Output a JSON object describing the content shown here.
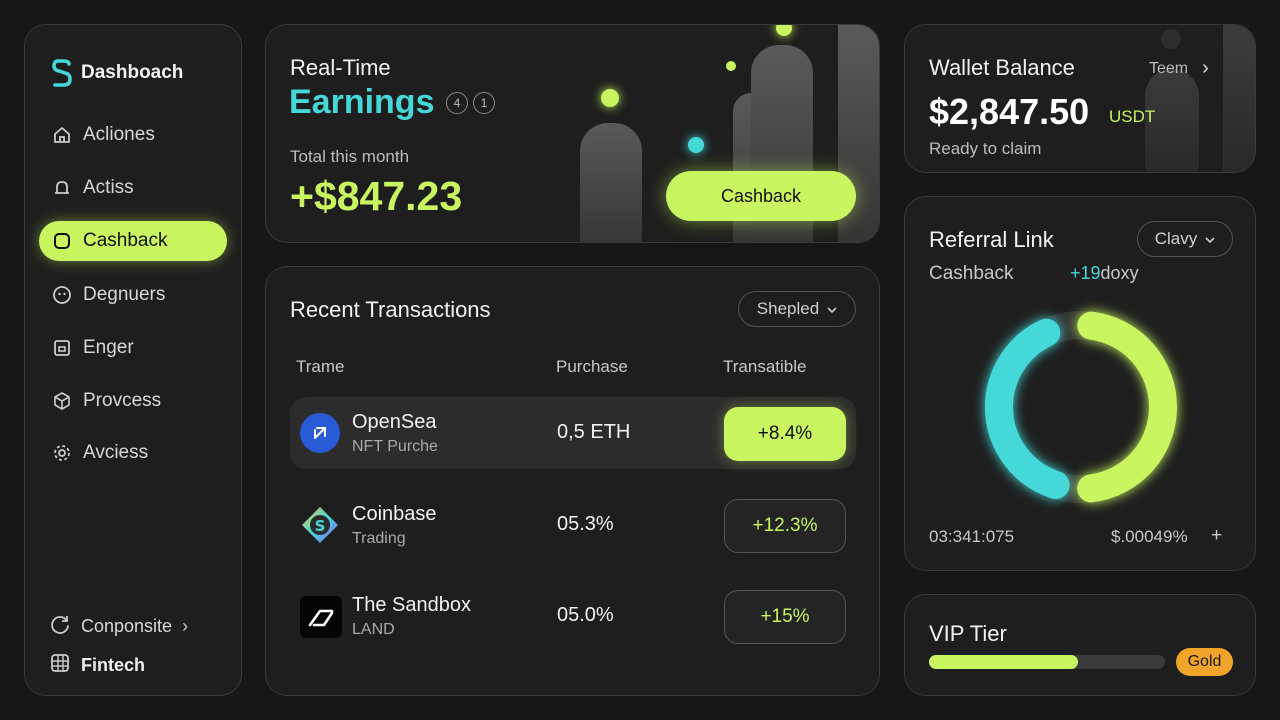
{
  "sidebar": {
    "brand": "Dashboach",
    "items": [
      {
        "label": "Acliones",
        "icon": "home-icon"
      },
      {
        "label": "Actiss",
        "icon": "bell-icon"
      },
      {
        "label": "Cashback",
        "icon": "square-icon",
        "active": true
      },
      {
        "label": "Degnuers",
        "icon": "face-icon"
      },
      {
        "label": "Enger",
        "icon": "wallet-icon"
      },
      {
        "label": "Provcess",
        "icon": "cube-icon"
      },
      {
        "label": "Avciess",
        "icon": "gear-icon"
      }
    ],
    "footer": [
      {
        "label": "Conponsite",
        "icon": "refresh-icon"
      },
      {
        "label": "Fintech",
        "icon": "grid-icon"
      }
    ]
  },
  "earnings": {
    "title_line1": "Real-Time",
    "title_line2": "Earnings",
    "badges": [
      "4",
      "1"
    ],
    "subtitle": "Total this month",
    "amount": "+$847.23",
    "button": "Cashback"
  },
  "transactions": {
    "title": "Recent Transactions",
    "filter": "Shepled",
    "columns": [
      "Trame",
      "Purchase",
      "Transatible"
    ],
    "rows": [
      {
        "name": "OpenSea",
        "desc": "NFT Purche",
        "purchase": "0,5 ETH",
        "change": "+8.4%"
      },
      {
        "name": "Coinbase",
        "desc": "Trading",
        "purchase": "05.3%",
        "change": "+12.3%"
      },
      {
        "name": "The Sandbox",
        "desc": "LAND",
        "purchase": "05.0%",
        "change": "+15%"
      }
    ]
  },
  "wallet": {
    "title": "Wallet Balance",
    "link": "Teem",
    "amount": "$2,847.50",
    "unit": "USDT",
    "status": "Ready to claim"
  },
  "referral": {
    "title": "Referral Link",
    "filter": "Clavy",
    "label": "Cashback",
    "pct": "+19",
    "pct_suffix": "doxy",
    "footer_left": "03:341:075",
    "footer_right": "$.00049%",
    "footer_plus": "+",
    "donut": {
      "cyan_fraction": 0.38,
      "lime_fraction": 0.46
    }
  },
  "vip": {
    "title": "VIP Tier",
    "progress": 0.63,
    "badge": "Gold"
  },
  "colors": {
    "accent": "#c8f560",
    "cyan": "#45d8d8",
    "gold": "#f0a42a"
  }
}
